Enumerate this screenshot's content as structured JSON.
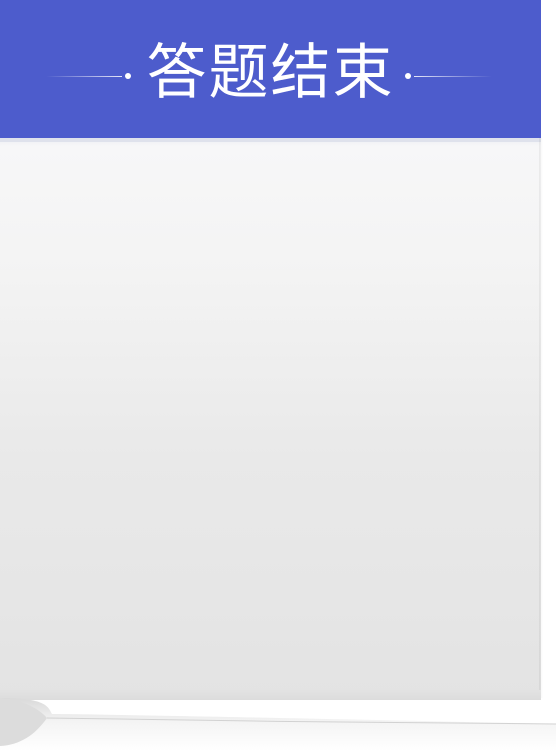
{
  "header": {
    "title": "答题结束",
    "background_color": "#4d5ccc",
    "text_color": "#ffffff"
  },
  "sheet": {
    "background_color": "#ececec"
  }
}
